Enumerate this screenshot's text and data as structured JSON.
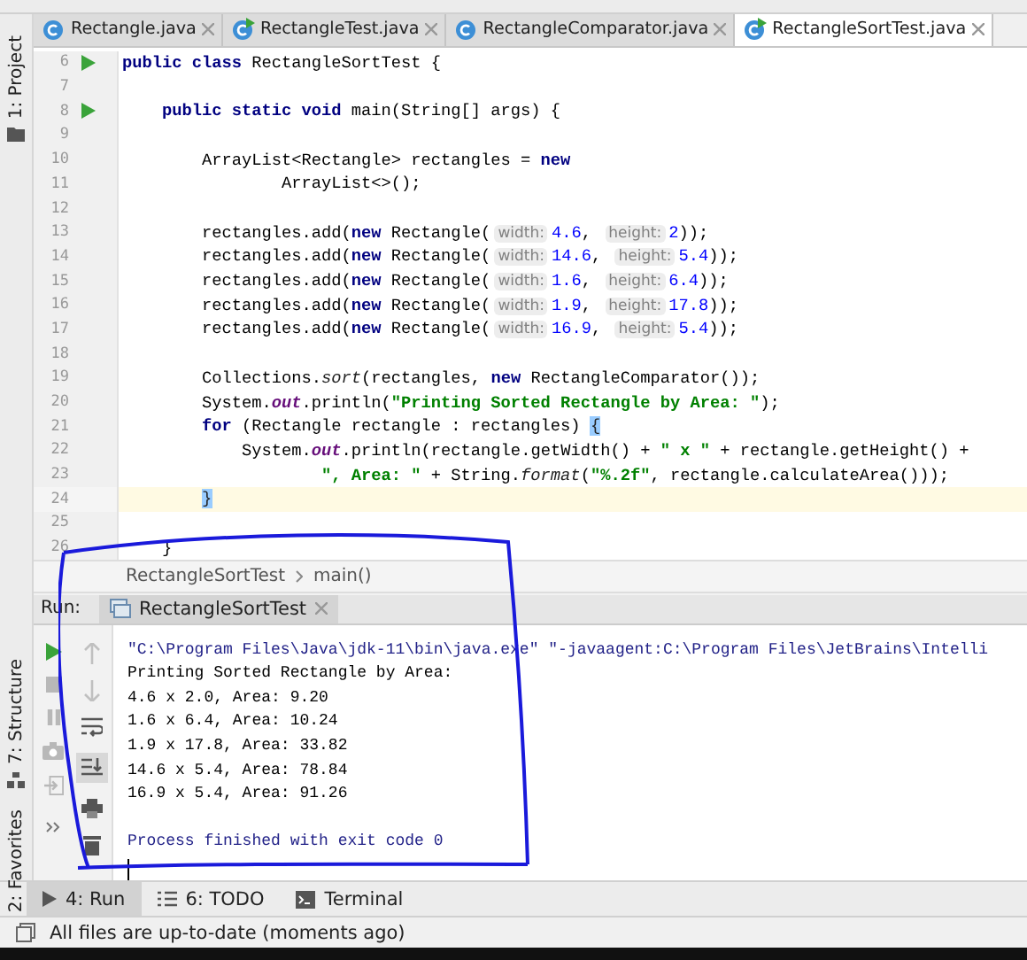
{
  "tabs": [
    {
      "label": "Rectangle.java",
      "runnable": false,
      "selected": false
    },
    {
      "label": "RectangleTest.java",
      "runnable": true,
      "selected": false
    },
    {
      "label": "RectangleComparator.java",
      "runnable": false,
      "selected": false
    },
    {
      "label": "RectangleSortTest.java",
      "runnable": true,
      "selected": true
    }
  ],
  "side_tools": [
    {
      "label": "1: Project",
      "kind": "project"
    },
    {
      "label": "7: Structure",
      "kind": "structure"
    },
    {
      "label": "2: Favorites",
      "kind": "favorites"
    }
  ],
  "editor": {
    "lines": [
      {
        "number": "6",
        "runnable": true,
        "current": false,
        "segments": [
          {
            "kind": "keyword",
            "text": "public class"
          },
          {
            "kind": "plain",
            "text": " RectangleSortTest {"
          }
        ]
      },
      {
        "number": "7",
        "runnable": false,
        "current": false
      },
      {
        "number": "8",
        "runnable": true,
        "current": false,
        "segments": [
          {
            "kind": "keyword",
            "text": "    public static void"
          },
          {
            "kind": "plain",
            "text": " main(String[] args) {"
          }
        ]
      },
      {
        "number": "9",
        "runnable": false,
        "current": false
      },
      {
        "number": "10",
        "runnable": false,
        "current": false,
        "segments": [
          {
            "kind": "plain",
            "text": "        ArrayList<Rectangle> rectangles = "
          },
          {
            "kind": "keyword",
            "text": "new"
          }
        ]
      },
      {
        "number": "11",
        "runnable": false,
        "current": false,
        "segments": [
          {
            "kind": "plain",
            "text": "                ArrayList<>();"
          }
        ]
      },
      {
        "number": "12",
        "runnable": false,
        "current": false
      },
      {
        "number": "13",
        "runnable": false,
        "current": false,
        "segments": [
          {
            "kind": "plain",
            "text": "        rectangles.add("
          },
          {
            "kind": "keyword",
            "text": "new"
          },
          {
            "kind": "plain",
            "text": " Rectangle("
          },
          {
            "kind": "hint",
            "text": "width:"
          },
          {
            "kind": "number",
            "text": "4.6"
          },
          {
            "kind": "plain",
            "text": ", "
          },
          {
            "kind": "hint",
            "text": "height:"
          },
          {
            "kind": "number",
            "text": "2"
          },
          {
            "kind": "plain",
            "text": "));"
          }
        ]
      },
      {
        "number": "14",
        "runnable": false,
        "current": false,
        "segments": [
          {
            "kind": "plain",
            "text": "        rectangles.add("
          },
          {
            "kind": "keyword",
            "text": "new"
          },
          {
            "kind": "plain",
            "text": " Rectangle("
          },
          {
            "kind": "hint",
            "text": "width:"
          },
          {
            "kind": "number",
            "text": "14.6"
          },
          {
            "kind": "plain",
            "text": ", "
          },
          {
            "kind": "hint",
            "text": "height:"
          },
          {
            "kind": "number",
            "text": "5.4"
          },
          {
            "kind": "plain",
            "text": "));"
          }
        ]
      },
      {
        "number": "15",
        "runnable": false,
        "current": false,
        "segments": [
          {
            "kind": "plain",
            "text": "        rectangles.add("
          },
          {
            "kind": "keyword",
            "text": "new"
          },
          {
            "kind": "plain",
            "text": " Rectangle("
          },
          {
            "kind": "hint",
            "text": "width:"
          },
          {
            "kind": "number",
            "text": "1.6"
          },
          {
            "kind": "plain",
            "text": ", "
          },
          {
            "kind": "hint",
            "text": "height:"
          },
          {
            "kind": "number",
            "text": "6.4"
          },
          {
            "kind": "plain",
            "text": "));"
          }
        ]
      },
      {
        "number": "16",
        "runnable": false,
        "current": false,
        "segments": [
          {
            "kind": "plain",
            "text": "        rectangles.add("
          },
          {
            "kind": "keyword",
            "text": "new"
          },
          {
            "kind": "plain",
            "text": " Rectangle("
          },
          {
            "kind": "hint",
            "text": "width:"
          },
          {
            "kind": "number",
            "text": "1.9"
          },
          {
            "kind": "plain",
            "text": ", "
          },
          {
            "kind": "hint",
            "text": "height:"
          },
          {
            "kind": "number",
            "text": "17.8"
          },
          {
            "kind": "plain",
            "text": "));"
          }
        ]
      },
      {
        "number": "17",
        "runnable": false,
        "current": false,
        "segments": [
          {
            "kind": "plain",
            "text": "        rectangles.add("
          },
          {
            "kind": "keyword",
            "text": "new"
          },
          {
            "kind": "plain",
            "text": " Rectangle("
          },
          {
            "kind": "hint",
            "text": "width:"
          },
          {
            "kind": "number",
            "text": "16.9"
          },
          {
            "kind": "plain",
            "text": ", "
          },
          {
            "kind": "hint",
            "text": "height:"
          },
          {
            "kind": "number",
            "text": "5.4"
          },
          {
            "kind": "plain",
            "text": "));"
          }
        ]
      },
      {
        "number": "18",
        "runnable": false,
        "current": false
      },
      {
        "number": "19",
        "runnable": false,
        "current": false,
        "segments": [
          {
            "kind": "plain",
            "text": "        Collections."
          },
          {
            "kind": "static",
            "text": "sort"
          },
          {
            "kind": "plain",
            "text": "(rectangles, "
          },
          {
            "kind": "keyword",
            "text": "new"
          },
          {
            "kind": "plain",
            "text": " RectangleComparator());"
          }
        ]
      },
      {
        "number": "20",
        "runnable": false,
        "current": false,
        "segments": [
          {
            "kind": "plain",
            "text": "        System."
          },
          {
            "kind": "field",
            "text": "out"
          },
          {
            "kind": "plain",
            "text": ".println("
          },
          {
            "kind": "string",
            "text": "\"Printing Sorted Rectangle by Area: \""
          },
          {
            "kind": "plain",
            "text": ");"
          }
        ]
      },
      {
        "number": "21",
        "runnable": false,
        "current": false,
        "segments": [
          {
            "kind": "keyword",
            "text": "        for"
          },
          {
            "kind": "plain",
            "text": " (Rectangle rectangle : rectangles) "
          },
          {
            "kind": "brace",
            "text": "{"
          }
        ]
      },
      {
        "number": "22",
        "runnable": false,
        "current": false,
        "segments": [
          {
            "kind": "plain",
            "text": "            System."
          },
          {
            "kind": "field",
            "text": "out"
          },
          {
            "kind": "plain",
            "text": ".println(rectangle.getWidth() + "
          },
          {
            "kind": "string",
            "text": "\" x \""
          },
          {
            "kind": "plain",
            "text": " + rectangle.getHeight() +"
          }
        ]
      },
      {
        "number": "23",
        "runnable": false,
        "current": false,
        "segments": [
          {
            "kind": "string",
            "text": "                    \", Area: \""
          },
          {
            "kind": "plain",
            "text": " + String."
          },
          {
            "kind": "static",
            "text": "format"
          },
          {
            "kind": "plain",
            "text": "("
          },
          {
            "kind": "string",
            "text": "\"%.2f\""
          },
          {
            "kind": "plain",
            "text": ", rectangle.calculateArea()));"
          }
        ]
      },
      {
        "number": "24",
        "runnable": false,
        "current": true,
        "segments": [
          {
            "kind": "brace",
            "text": "        }"
          }
        ]
      },
      {
        "number": "25",
        "runnable": false,
        "current": false
      },
      {
        "number": "26",
        "runnable": false,
        "current": false,
        "segments": [
          {
            "kind": "plain",
            "text": "    }"
          }
        ]
      }
    ]
  },
  "breadcrumb": [
    "RectangleSortTest",
    "main()"
  ],
  "run_panel": {
    "label": "Run:",
    "tab": "RectangleSortTest",
    "console": [
      {
        "kind": "command",
        "text": "\"C:\\Program Files\\Java\\jdk-11\\bin\\java.exe\" \"-javaagent:C:\\Program Files\\JetBrains\\Intelli"
      },
      {
        "kind": "output",
        "text": "Printing Sorted Rectangle by Area:"
      },
      {
        "kind": "output",
        "text": "4.6 x 2.0, Area: 9.20"
      },
      {
        "kind": "output",
        "text": "1.6 x 6.4, Area: 10.24"
      },
      {
        "kind": "output",
        "text": "1.9 x 17.8, Area: 33.82"
      },
      {
        "kind": "output",
        "text": "14.6 x 5.4, Area: 78.84"
      },
      {
        "kind": "output",
        "text": "16.9 x 5.4, Area: 91.26"
      },
      {
        "kind": "blank"
      },
      {
        "kind": "exit",
        "text": "Process finished with exit code 0"
      }
    ]
  },
  "tool_tabs": [
    {
      "label": "4: Run",
      "kind": "run",
      "selected": true
    },
    {
      "label": "6: TODO",
      "kind": "todo",
      "selected": false
    },
    {
      "label": "Terminal",
      "kind": "terminal",
      "selected": false
    }
  ],
  "status_bar": "All files are up-to-date (moments ago)"
}
